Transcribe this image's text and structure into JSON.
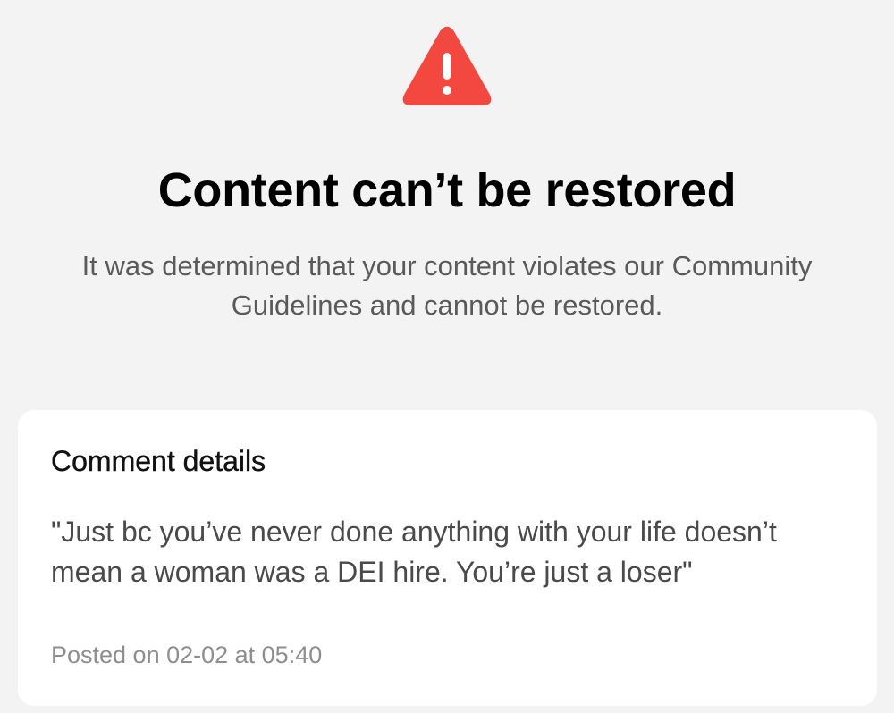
{
  "header": {
    "icon": "warning-triangle-icon",
    "icon_color": "#f2483f",
    "title": "Content can’t be restored",
    "description": "It was determined that your content violates our Community Guidelines and cannot be restored."
  },
  "comment_card": {
    "heading": "Comment details",
    "text": "\"Just bc you’ve never done anything with your life doesn’t mean a woman was a DEI hire. You’re just a loser\"",
    "posted": "Posted on 02-02 at 05:40"
  }
}
